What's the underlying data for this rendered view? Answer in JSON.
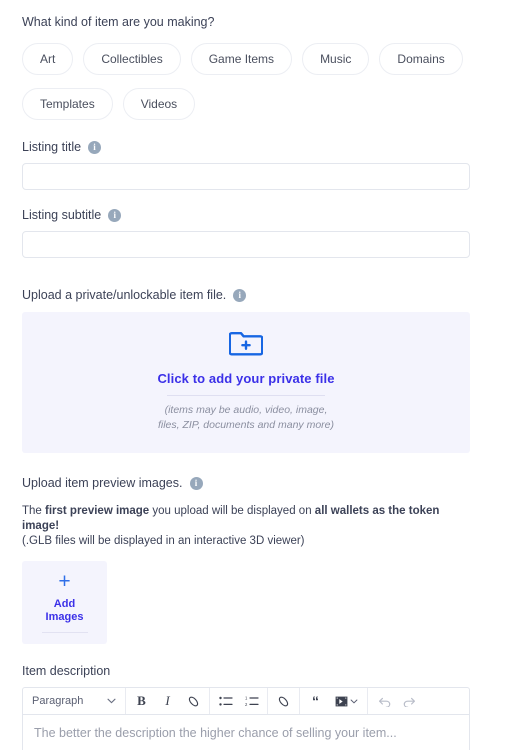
{
  "form": {
    "category_question": "What kind of item are you making?",
    "categories": [
      "Art",
      "Collectibles",
      "Game Items",
      "Music",
      "Domains",
      "Templates",
      "Videos"
    ],
    "listing_title": {
      "label": "Listing title",
      "value": "",
      "placeholder": "",
      "info_icon": "info-icon"
    },
    "listing_subtitle": {
      "label": "Listing subtitle",
      "value": "",
      "placeholder": "",
      "info_icon": "info-icon"
    },
    "private_file": {
      "label": "Upload a private/unlockable item file.",
      "icon": "folder-plus-icon",
      "link_text": "Click to add your private file",
      "note": "(items may be audio, video, image, files, ZIP, documents and many more)"
    },
    "preview_images": {
      "label": "Upload item preview images.",
      "notice_part1": "The ",
      "notice_bold1": "first preview image",
      "notice_part2": " you upload will be displayed on ",
      "notice_bold2": "all wallets as the token image!",
      "notice_line2": "(.GLB files will be displayed in an interactive 3D viewer)",
      "add_plus": "+",
      "add_label_line1": "Add",
      "add_label_line2": "Images"
    },
    "description": {
      "label": "Item description",
      "placeholder": "The better the description the higher chance of selling your item...",
      "value": "",
      "toolbar": {
        "block_format": "Paragraph",
        "chevron": "⌄",
        "bold": "B",
        "italic": "I",
        "link": "⊘",
        "bullet_list": "☰",
        "numbered_list": "☷",
        "attach": "⊘",
        "blockquote": "“",
        "media": "▶",
        "media_chevron": "⌄",
        "undo": "↩",
        "redo": "↪"
      }
    }
  },
  "colors": {
    "accent_blue": "#3b30e8",
    "icon_blue": "#2f6fe8",
    "dropzone_bg": "#f4f4fd",
    "border": "#e3e6ed",
    "text": "#3c4257",
    "info_icon": "#97a8bb"
  }
}
